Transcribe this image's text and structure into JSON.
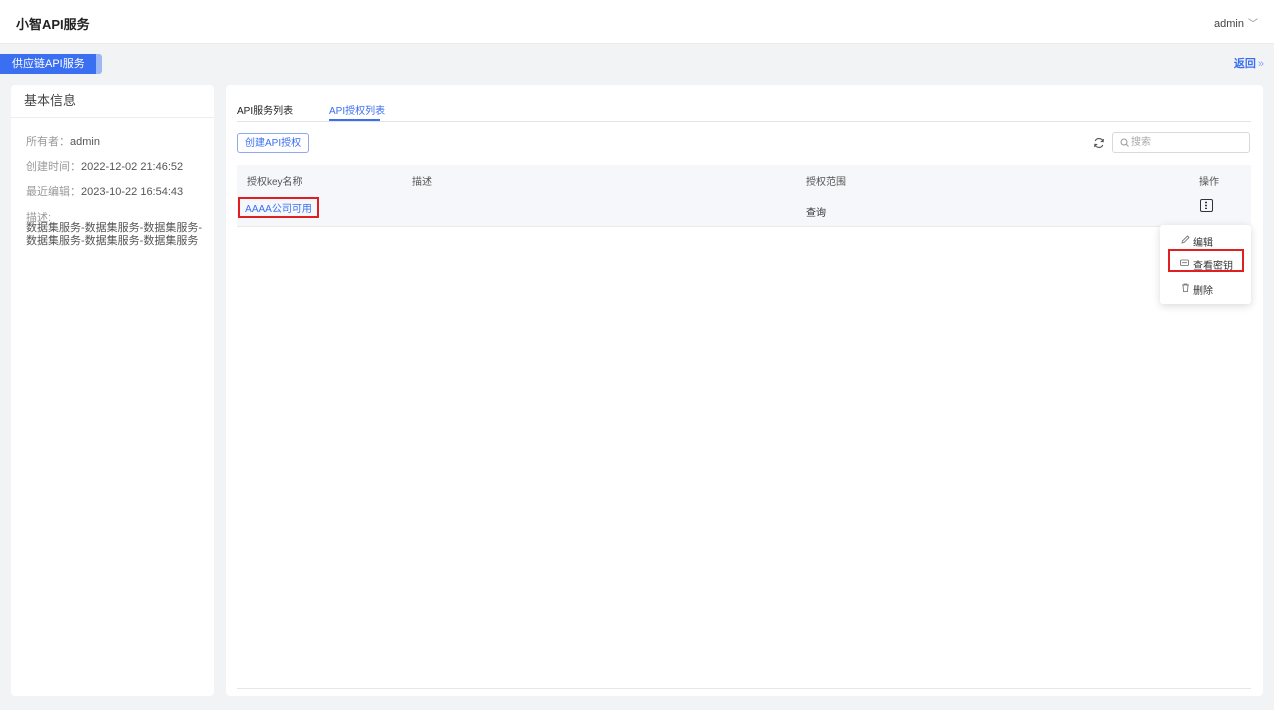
{
  "app": {
    "title": "小智API服务",
    "user": "admin"
  },
  "nav": {
    "service_tag": "供应链API服务",
    "back_label": "返回",
    "back_arrow": "»"
  },
  "info": {
    "panel_title": "基本信息",
    "owner_label": "所有者：",
    "owner": "admin",
    "created_label": "创建时间：",
    "created": "2022-12-02 21:46:52",
    "edited_label": "最近编辑：",
    "edited": "2023-10-22 16:54:43",
    "desc_label": "描述:",
    "desc": "数据集服务-数据集服务-数据集服务-数据集服务-数据集服务-数据集服务"
  },
  "tabs": [
    {
      "label": "API服务列表",
      "active": false
    },
    {
      "label": "API授权列表",
      "active": true
    }
  ],
  "toolbar": {
    "create_label": "创建API授权",
    "search_placeholder": "搜索"
  },
  "table": {
    "headers": {
      "name": "授权key名称",
      "desc": "描述",
      "scope": "授权范围",
      "action": "操作"
    },
    "rows": [
      {
        "name": "AAAA公司可用",
        "desc": "",
        "scope": "查询"
      }
    ]
  },
  "menu": {
    "edit": "编辑",
    "view_key": "查看密钥",
    "delete": "删除"
  },
  "colors": {
    "accent": "#3a6ff2",
    "highlight": "#e02020"
  }
}
